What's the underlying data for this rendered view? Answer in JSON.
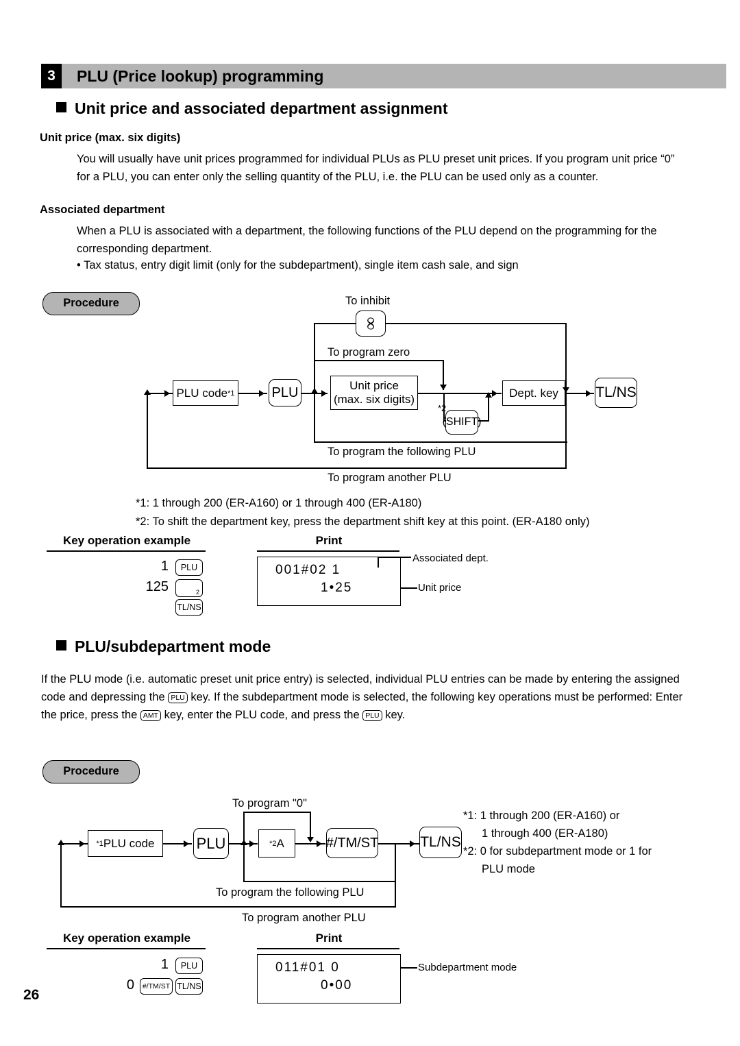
{
  "page": {
    "number": "26"
  },
  "section": {
    "number": "3",
    "title": "PLU (Price lookup) programming"
  },
  "block1": {
    "heading": "Unit price and associated department assignment",
    "sub1_title": "Unit price (max. six digits)",
    "sub1_body": "You will usually have unit prices programmed for individual PLUs as PLU preset unit prices. If you program unit price “0” for a PLU, you can enter only the selling quantity of the PLU, i.e. the PLU can be used only as a counter.",
    "sub2_title": "Associated department",
    "sub2_body": "When a PLU is associated with a department, the following functions of the PLU depend on the programming for the corresponding department.",
    "sub2_bullet": "• Tax status, entry digit limit (only for the subdepartment), single item cash sale, and sign",
    "procedure_label": "Procedure",
    "diagram": {
      "label_to_inhibit": "To inhibit",
      "label_to_program_zero": "To program zero",
      "label_following_plu": "To program the following PLU",
      "label_another_plu": "To program another PLU",
      "node_plu_code": "PLU code",
      "node_plu_code_sup": "*1",
      "key_plu": "PLU",
      "key_inhibit": "∞",
      "node_unit_price_l1": "Unit price",
      "node_unit_price_l2": "(max. six digits)",
      "mark_shift": "*2",
      "key_shift": "(SHIFT)",
      "node_dept_key": "Dept. key",
      "key_tlns": "TL/NS"
    },
    "footnote1": "*1: 1 through 200 (ER-A160) or 1 through 400 (ER-A180)",
    "footnote2": "*2: To shift the department key, press the department shift key at this point. (ER-A180 only)",
    "keyop_header": "Key operation example",
    "print_header": "Print",
    "keyop": {
      "row1_num": "1",
      "row1_key": "PLU",
      "row2_num": "125",
      "row2_key_sub": "2",
      "row3_key": "TL/NS"
    },
    "print": {
      "line1": "001#02   1",
      "line2": "1•25",
      "callout1": "Associated dept.",
      "callout2": "Unit price"
    }
  },
  "block2": {
    "heading": "PLU/subdepartment mode",
    "body_part1": "If the PLU mode (i.e. automatic preset unit price entry) is selected, individual PLU entries can be made by entering the assigned code and depressing the ",
    "inline_key_plu": "PLU",
    "body_part2": " key.  If the subdepartment mode is selected, the following key operations must be performed:  Enter the price, press the ",
    "inline_key_amt": "AMT",
    "body_part3": " key, enter the PLU code, and press the ",
    "inline_key_plu2": "PLU",
    "body_part4": " key.",
    "procedure_label": "Procedure",
    "diagram": {
      "label_to_program_0": "To program \"0\"",
      "label_following_plu": "To program the following PLU",
      "label_another_plu": "To program another PLU",
      "node_plu_code_sup": "*1",
      "node_plu_code": "PLU code",
      "key_plu": "PLU",
      "node_a_sup": "*2",
      "node_a": "A",
      "key_tmst": "#/TM/ST",
      "key_tlns": "TL/NS"
    },
    "footnote1_l1": "*1: 1 through 200 (ER-A160) or",
    "footnote1_l2": "1 through 400 (ER-A180)",
    "footnote2_l1": "*2: 0 for subdepartment mode or 1 for",
    "footnote2_l2": "PLU mode",
    "keyop_header": "Key operation example",
    "print_header": "Print",
    "keyop": {
      "row1_num": "1",
      "row1_key": "PLU",
      "row2_num": "0",
      "row2_key1": "#/TM/ST",
      "row2_key2": "TL/NS"
    },
    "print": {
      "line1": "011#01   0",
      "line2": "0•00",
      "callout1": "Subdepartment mode"
    }
  }
}
